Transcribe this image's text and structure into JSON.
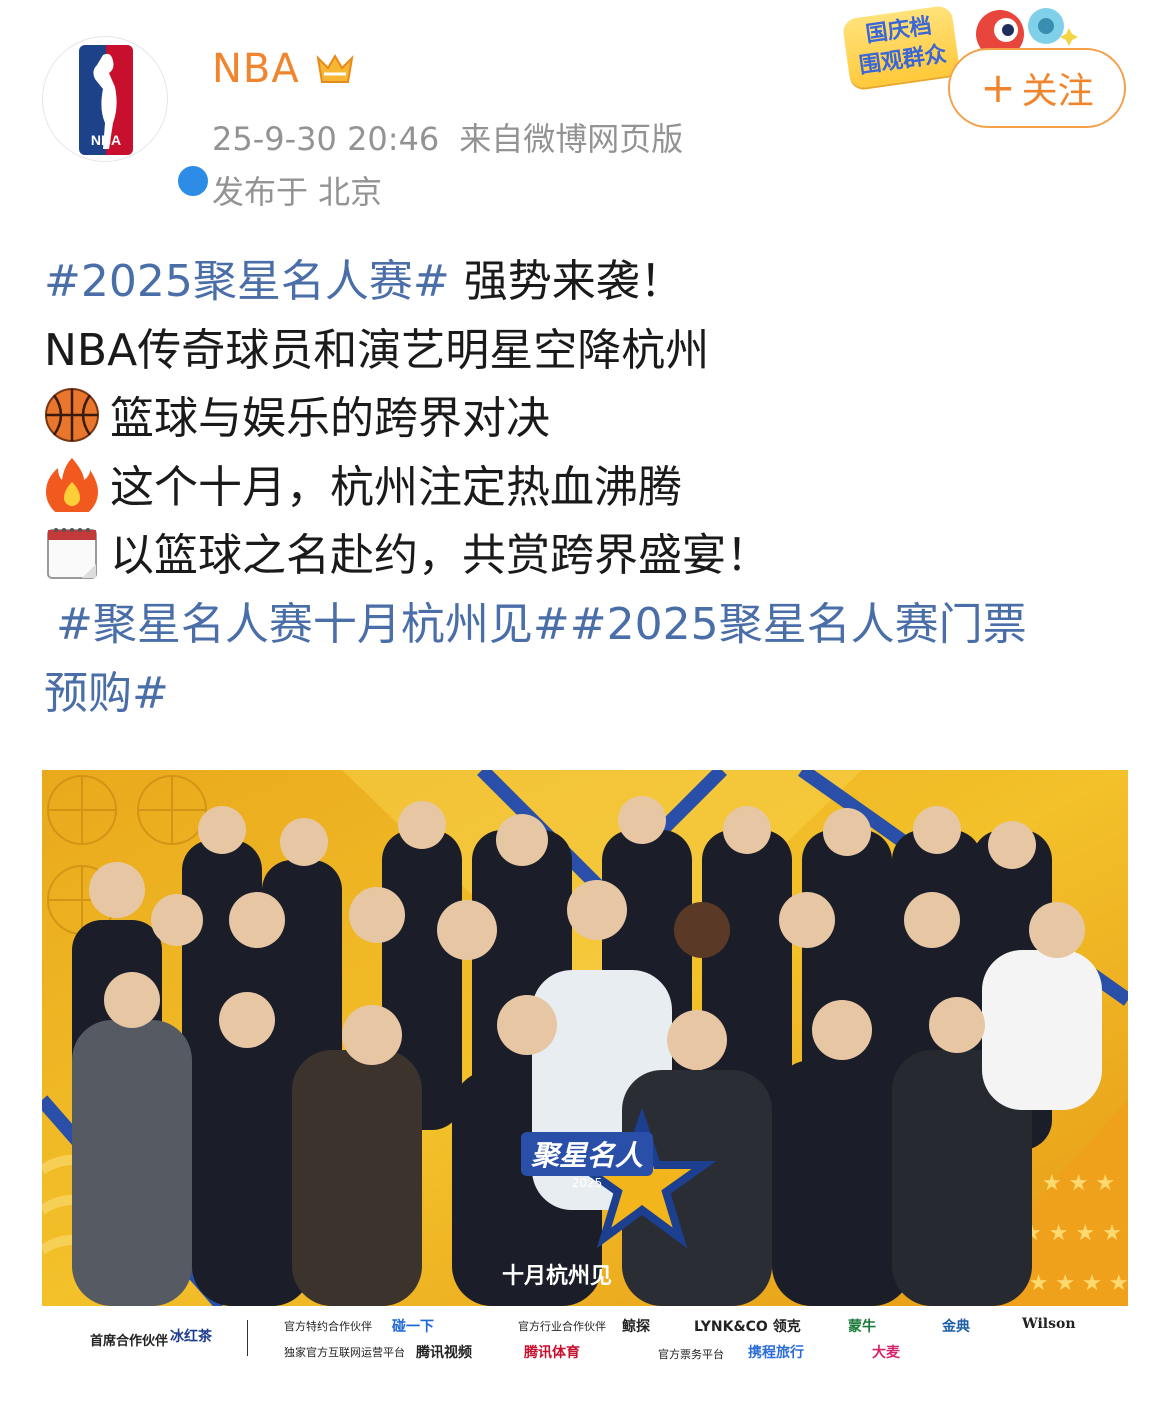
{
  "account": {
    "name": "NBA",
    "avatar_icon": "nba-logo-icon",
    "badge_icon": "vip-crown-icon",
    "verified_icon": "verified-check-icon",
    "timestamp": "25-9-30 20:46",
    "source": "来自微博网页版",
    "location": "发布于 北京"
  },
  "festival_badge": {
    "line1": "国庆档",
    "line2": "围观群众"
  },
  "follow_button": {
    "plus": "+",
    "label": "关注"
  },
  "post": {
    "line1_tag": "#2025聚星名人赛#",
    "line1_text": " 强势来袭！",
    "line2": "NBA传奇球员和演艺明星空降杭州",
    "line3_icon": "basketball-icon",
    "line3": "篮球与娱乐的跨界对决",
    "line4_icon": "fire-icon",
    "line4": "这个十月，杭州注定热血沸腾",
    "line5_icon": "calendar-icon",
    "line5": "以篮球之名赴约，共赏跨界盛宴！",
    "tag2": "#聚星名人赛十月杭州见#",
    "tag3_part1": "#2025聚星名人赛门票",
    "tag3_part2": "预购#"
  },
  "poster": {
    "title": "聚星名人",
    "year": "2025",
    "date": "十月杭州见",
    "colors": {
      "yellow": "#f2b51c",
      "orange": "#e8a019",
      "blue": "#2a4fa8",
      "dark": "#1c2b4a"
    },
    "sponsors": {
      "lead_label": "首席合作伙伴",
      "lead_brand": "冰红茶",
      "official_partner_label": "官方特约合作伙伴",
      "official_partner": "碰一下",
      "internet_label": "独家官方互联网运营平台",
      "internet": "腾讯视频",
      "industry_label": "官方行业合作伙伴",
      "tencent_sports": "腾讯体育",
      "brand1": "鲸探",
      "brand2": "LYNK&CO 领克",
      "brand3": "蒙牛",
      "brand4": "金典",
      "brand5": "Wilson",
      "ticket_label": "官方票务平台",
      "ticket1": "携程旅行",
      "ticket2": "大麦"
    }
  }
}
